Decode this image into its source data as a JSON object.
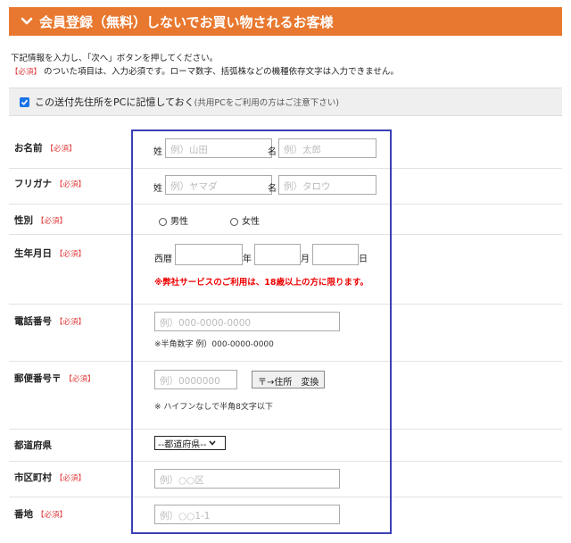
{
  "header": {
    "title": "会員登録（無料）しないでお買い物されるお客様"
  },
  "intro": {
    "line1": "下記情報を入力し、「次へ」ボタンを押してください。",
    "required_tag": "【必須】",
    "line2": "のついた項目は、入力必須です。ローマ数字、括弧株などの機種依存文字は入力できません。"
  },
  "memory": {
    "label": "この送付先住所をPCに記憶しておく",
    "note": "(共用PCをご利用の方はご注意下さい)"
  },
  "required": "【必須】",
  "form": {
    "name": {
      "label": "お名前",
      "sei": "姓",
      "sei_ph": "例）山田",
      "mei": "名",
      "mei_ph": "例）太郎"
    },
    "kana": {
      "label": "フリガナ",
      "sei": "姓",
      "sei_ph": "例）ヤマダ",
      "mei": "名",
      "mei_ph": "例）タロウ"
    },
    "gender": {
      "label": "性別",
      "male": "男性",
      "female": "女性"
    },
    "birth": {
      "label": "生年月日",
      "era": "西暦",
      "year": "年",
      "month": "月",
      "day": "日",
      "warning": "※弊社サービスのご利用は、18歳以上の方に限ります。"
    },
    "phone": {
      "label": "電話番号",
      "placeholder": "例）000-0000-0000",
      "note": "※半角数字 例）000-0000-0000"
    },
    "zip": {
      "label": "郵便番号〒",
      "placeholder": "例）0000000",
      "button": "〒→住所　変換",
      "note": "※ ハイフンなしで半角8文字以下"
    },
    "pref": {
      "label": "都道府県",
      "selected": "--都道府県--"
    },
    "city": {
      "label": "市区町村",
      "placeholder": "例）○○区"
    },
    "street": {
      "label": "番地",
      "placeholder": "例）○○1-1"
    }
  }
}
